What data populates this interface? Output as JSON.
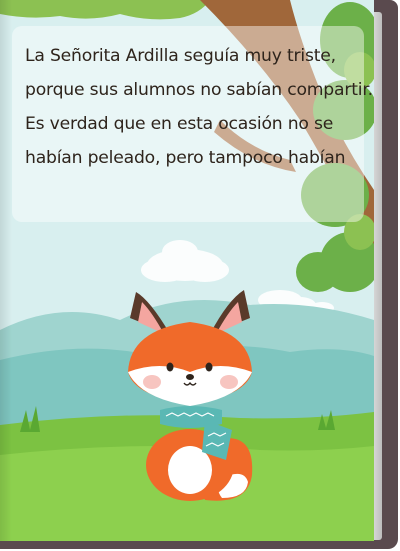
{
  "story": {
    "lines": [
      "La Señorita Ardilla seguía muy triste,",
      "porque sus alumnos no sabían compartir.",
      "Es verdad que en esta ocasión no se",
      "habían peleado, pero tampoco habían"
    ]
  },
  "illustration": {
    "subject": "fox-with-scarf",
    "colors": {
      "sky": "#d8efef",
      "grass": "#7cc242",
      "fox_orange": "#f06a2a",
      "scarf": "#5ab8b4",
      "book_cover": "#5a4a4e"
    }
  }
}
